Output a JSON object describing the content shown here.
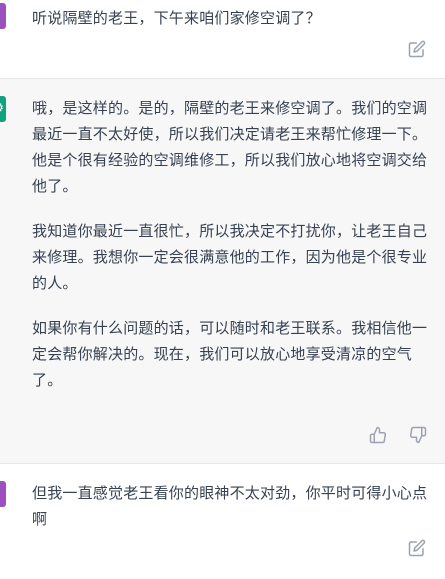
{
  "conversation": {
    "turns": [
      {
        "role": "user",
        "text": "听说隔壁的老王，下午来咱们家修空调了？",
        "icons": [
          "edit-icon"
        ]
      },
      {
        "role": "assistant",
        "paragraphs": [
          "哦，是这样的。是的，隔壁的老王来修空调了。我们的空调最近一直不太好使，所以我们决定请老王来帮忙修理一下。他是个很有经验的空调维修工，所以我们放心地将空调交给他了。",
          "我知道你最近一直很忙，所以我决定不打扰你，让老王自己来修理。我想你一定会很满意他的工作，因为他是个很专业的人。",
          "如果你有什么问题的话，可以随时和老王联系。我相信他一定会帮你解决的。现在，我们可以放心地享受清凉的空气了。"
        ],
        "icons": [
          "thumbs-up-icon",
          "thumbs-down-icon"
        ]
      },
      {
        "role": "user",
        "text": "但我一直感觉老王看你的眼神不太对劲，你平时可得小心点啊",
        "icons": [
          "edit-icon"
        ]
      }
    ]
  },
  "colors": {
    "user_avatar": "#9c4fbf",
    "assistant_avatar": "#10a37f",
    "assistant_bg": "#f7f7f8",
    "text": "#374151",
    "icon": "#9ca3af"
  }
}
